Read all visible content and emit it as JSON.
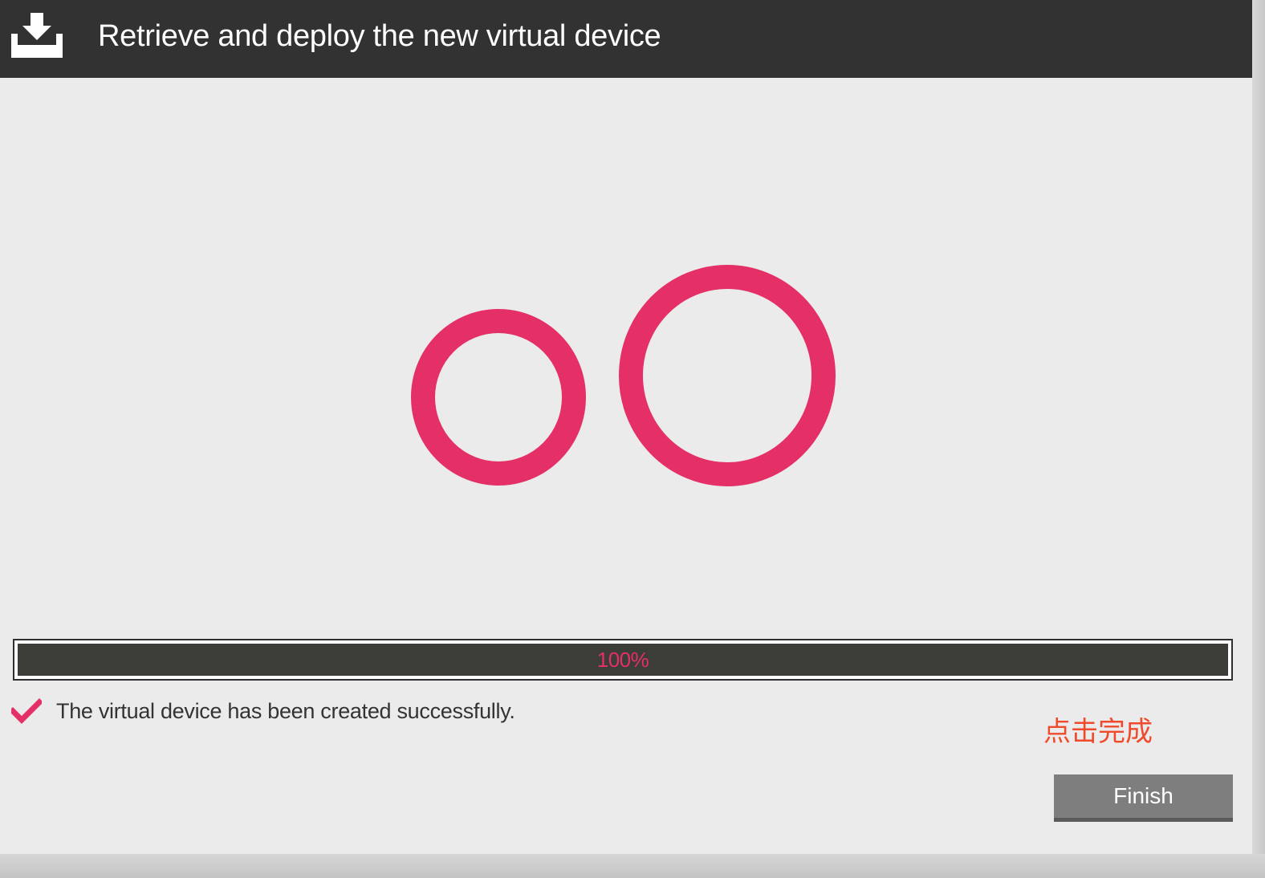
{
  "titlebar": {
    "title": "Retrieve and deploy the new virtual device",
    "icon": "download-tray-icon"
  },
  "logo": {
    "icon": "two-circles-logo",
    "color": "#e42f67"
  },
  "progress": {
    "value": 1.0,
    "label": "100%",
    "text_color": "#e42f67"
  },
  "status": {
    "icon": "checkmark-icon",
    "message": "The virtual device has been created successfully."
  },
  "annotation": {
    "text": "点击完成",
    "color": "#ef4a2c"
  },
  "actions": {
    "finish_label": "Finish"
  }
}
